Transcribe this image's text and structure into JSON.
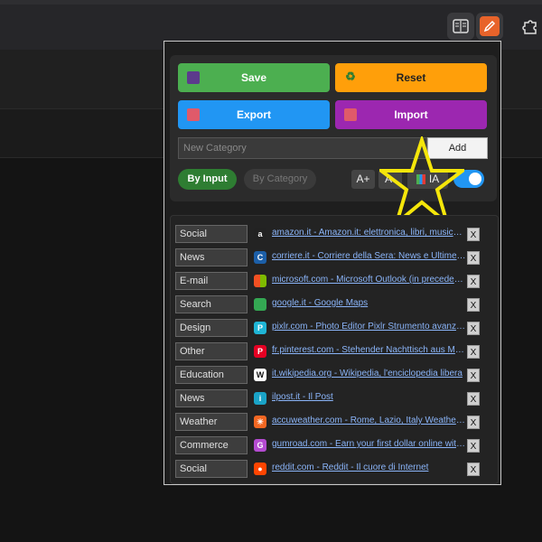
{
  "toolbar": {
    "icons": [
      "reader-view-icon",
      "pencil-extension-icon",
      "puzzle-extensions-icon"
    ]
  },
  "popup": {
    "save_label": "Save",
    "reset_label": "Reset",
    "export_label": "Export",
    "import_label": "Import",
    "new_category_placeholder": "New Category",
    "add_label": "Add",
    "by_input_label": "By Input",
    "by_category_label": "By Category",
    "font_increase_label": "A+",
    "font_decrease_label": "A-",
    "ia_label": "IA",
    "toggle_on": true
  },
  "bookmarks": [
    {
      "category": "Social",
      "text": "amazon.it - Amazon.it: elettronica, libri, musica, fashion",
      "icon": "amazon-icon",
      "color": "#222222",
      "glyph": "a"
    },
    {
      "category": "News",
      "text": "corriere.it - Corriere della Sera: News e Ultime notizie",
      "icon": "corriere-icon",
      "color": "#1c5fa8",
      "glyph": "C"
    },
    {
      "category": "E-mail",
      "text": "microsoft.com - Microsoft Outlook (in precedenza Hotmail)",
      "icon": "microsoft-icon",
      "color": "#f25022",
      "glyph": ""
    },
    {
      "category": "Search",
      "text": "google.it - Google Maps",
      "icon": "google-maps-icon",
      "color": "#34a853",
      "glyph": ""
    },
    {
      "category": "Design",
      "text": "pixlr.com - Photo Editor Pixlr Strumento avanzato",
      "icon": "pixlr-icon",
      "color": "#1fb5d6",
      "glyph": "P"
    },
    {
      "category": "Other",
      "text": "fr.pinterest.com - Stehender Nachttisch aus Massivholz",
      "icon": "pinterest-icon",
      "color": "#e60023",
      "glyph": "P"
    },
    {
      "category": "Education",
      "text": "it.wikipedia.org - Wikipedia, l'enciclopedia libera",
      "icon": "wikipedia-icon",
      "color": "#ffffff",
      "glyph": "W"
    },
    {
      "category": "News",
      "text": "ilpost.it - Il Post",
      "icon": "ilpost-icon",
      "color": "#1aa3c7",
      "glyph": "i"
    },
    {
      "category": "Weather",
      "text": "accuweather.com - Rome, Lazio, Italy Weather Forecast",
      "icon": "accuweather-icon",
      "color": "#f26722",
      "glyph": "☀"
    },
    {
      "category": "Commerce",
      "text": "gumroad.com - Earn your first dollar online with Gumroad",
      "icon": "gumroad-icon",
      "color": "#b44bd1",
      "glyph": "G"
    },
    {
      "category": "Social",
      "text": "reddit.com - Reddit - Il cuore di Internet",
      "icon": "reddit-icon",
      "color": "#ff4500",
      "glyph": "●"
    }
  ],
  "delete_label": "X"
}
